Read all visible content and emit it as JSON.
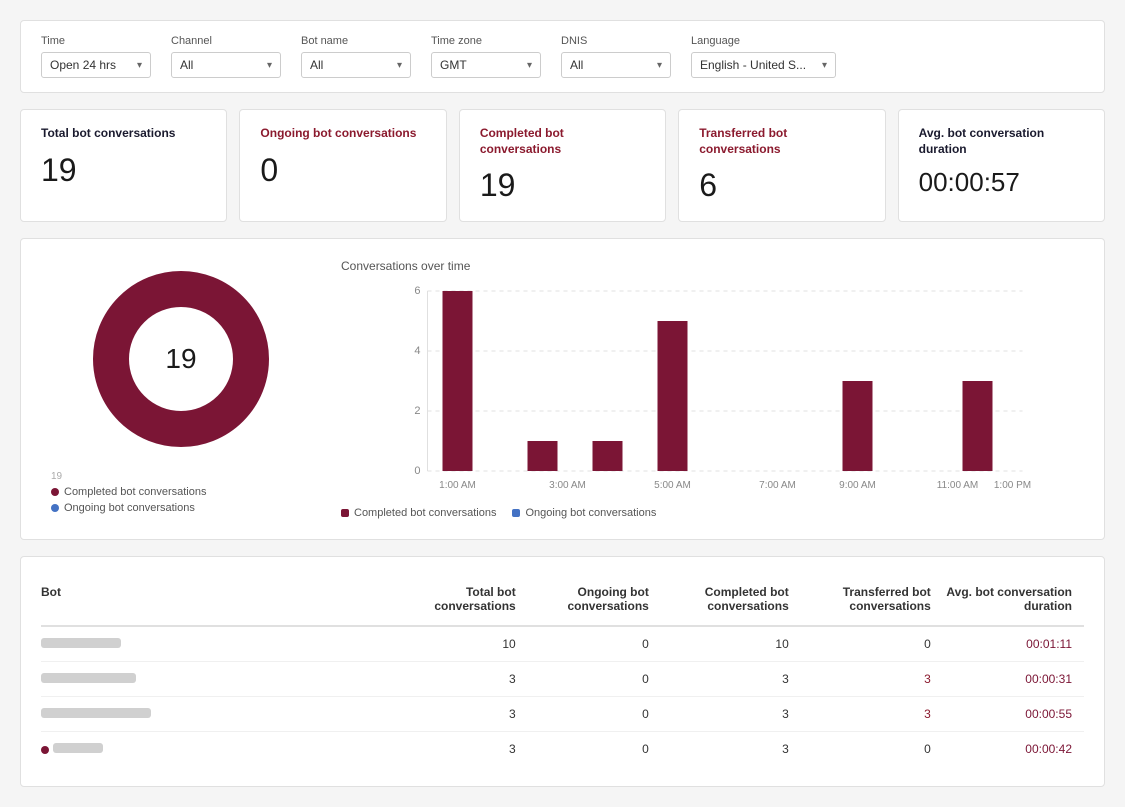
{
  "filters": {
    "time_label": "Time",
    "time_value": "Open 24 hrs",
    "channel_label": "Channel",
    "channel_value": "All",
    "botname_label": "Bot name",
    "botname_value": "All",
    "timezone_label": "Time zone",
    "timezone_value": "GMT",
    "dnis_label": "DNIS",
    "dnis_value": "All",
    "language_label": "Language",
    "language_value": "English - United S..."
  },
  "stats": {
    "total_label": "Total bot conversations",
    "total_value": "19",
    "ongoing_label": "Ongoing bot conversations",
    "ongoing_value": "0",
    "completed_label": "Completed bot conversations",
    "completed_value": "19",
    "transferred_label": "Transferred bot conversations",
    "transferred_value": "6",
    "avg_label": "Avg. bot conversation duration",
    "avg_value": "00:00:57"
  },
  "donut": {
    "center_value": "19",
    "completed_color": "#7b1535",
    "ongoing_color": "#4472c4",
    "legend_completed": "Completed bot conversations",
    "legend_ongoing": "Ongoing bot conversations",
    "note": "19"
  },
  "bar_chart": {
    "title": "Conversations over time",
    "legend_completed": "Completed bot conversations",
    "legend_ongoing": "Ongoing bot conversations",
    "bar_color": "#7b1535",
    "y_labels": [
      "0",
      "2",
      "4",
      "6"
    ],
    "x_labels": [
      "1:00 AM",
      "3:00 AM",
      "5:00 AM",
      "7:00 AM",
      "9:00 AM",
      "11:00 AM",
      "1:00 PM"
    ],
    "bars": [
      6,
      1,
      1,
      5,
      0,
      0,
      3,
      0,
      3
    ]
  },
  "table": {
    "col_bot": "Bot",
    "col_total": "Total bot conversations",
    "col_ongoing": "Ongoing bot conversations",
    "col_completed": "Completed bot conversations",
    "col_transferred": "Transferred bot conversations",
    "col_avg": "Avg. bot conversation duration",
    "rows": [
      {
        "bot_width": 80,
        "total": "10",
        "ongoing": "0",
        "completed": "10",
        "transferred": "0",
        "avg": "00:01:11",
        "transferred_red": false
      },
      {
        "bot_width": 95,
        "total": "3",
        "ongoing": "0",
        "completed": "3",
        "transferred": "3",
        "avg": "00:00:31",
        "transferred_red": true
      },
      {
        "bot_width": 110,
        "total": "3",
        "ongoing": "0",
        "completed": "3",
        "transferred": "3",
        "avg": "00:00:55",
        "transferred_red": true
      },
      {
        "bot_width": 65,
        "total": "3",
        "ongoing": "0",
        "completed": "3",
        "transferred": "0",
        "avg": "00:00:42",
        "transferred_red": false
      }
    ]
  },
  "accent_color": "#7b1535",
  "blue_color": "#4472c4"
}
